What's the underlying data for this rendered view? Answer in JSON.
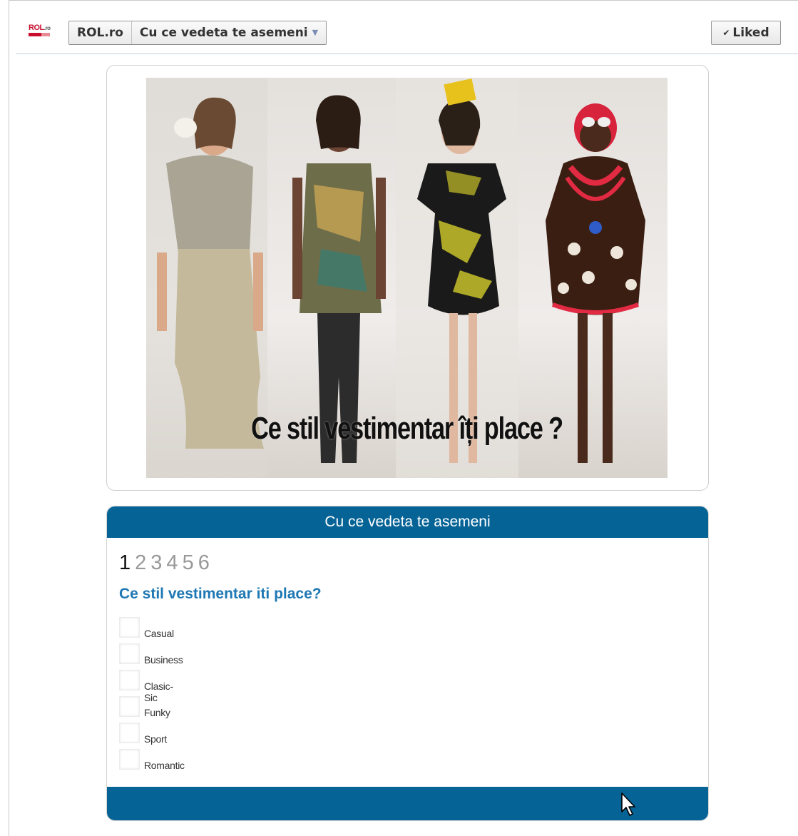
{
  "header": {
    "logo_main": "ROL",
    "logo_sub": ".ro",
    "breadcrumb": [
      "ROL.ro",
      "Cu ce vedeta te asemeni"
    ],
    "liked_label": "Liked"
  },
  "image_card": {
    "caption": "Ce stil vestimentar îți place ?"
  },
  "quiz": {
    "title": "Cu ce vedeta te asemeni",
    "pages": [
      "1",
      "2",
      "3",
      "4",
      "5",
      "6"
    ],
    "current_page": "1",
    "question": "Ce stil vestimentar iti place?",
    "options": [
      "Casual",
      "Business",
      "Clasic-Sic",
      "Funky",
      "Sport",
      "Romantic"
    ]
  },
  "colors": {
    "accent": "#066396",
    "question": "#1e78b4",
    "logo_red": "#c8102e"
  },
  "icons": {
    "liked": "checkmark-icon",
    "dropdown": "caret-down-icon",
    "cursor": "mouse-pointer-icon"
  }
}
